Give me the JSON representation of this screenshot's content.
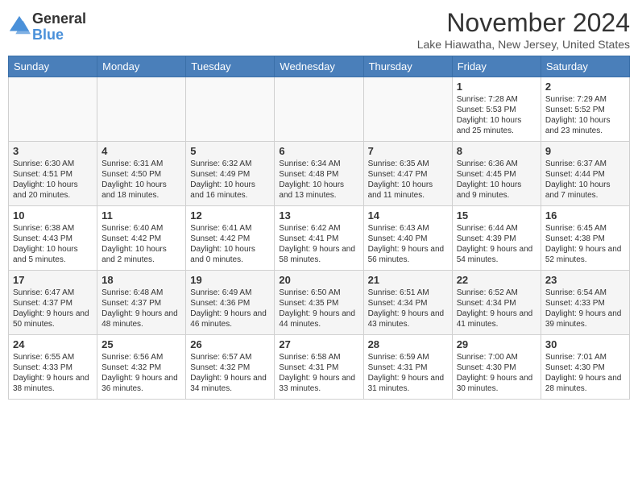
{
  "header": {
    "logo_line1": "General",
    "logo_line2": "Blue",
    "month": "November 2024",
    "location": "Lake Hiawatha, New Jersey, United States"
  },
  "days_of_week": [
    "Sunday",
    "Monday",
    "Tuesday",
    "Wednesday",
    "Thursday",
    "Friday",
    "Saturday"
  ],
  "weeks": [
    [
      {
        "day": "",
        "info": ""
      },
      {
        "day": "",
        "info": ""
      },
      {
        "day": "",
        "info": ""
      },
      {
        "day": "",
        "info": ""
      },
      {
        "day": "",
        "info": ""
      },
      {
        "day": "1",
        "info": "Sunrise: 7:28 AM\nSunset: 5:53 PM\nDaylight: 10 hours and 25 minutes."
      },
      {
        "day": "2",
        "info": "Sunrise: 7:29 AM\nSunset: 5:52 PM\nDaylight: 10 hours and 23 minutes."
      }
    ],
    [
      {
        "day": "3",
        "info": "Sunrise: 6:30 AM\nSunset: 4:51 PM\nDaylight: 10 hours and 20 minutes."
      },
      {
        "day": "4",
        "info": "Sunrise: 6:31 AM\nSunset: 4:50 PM\nDaylight: 10 hours and 18 minutes."
      },
      {
        "day": "5",
        "info": "Sunrise: 6:32 AM\nSunset: 4:49 PM\nDaylight: 10 hours and 16 minutes."
      },
      {
        "day": "6",
        "info": "Sunrise: 6:34 AM\nSunset: 4:48 PM\nDaylight: 10 hours and 13 minutes."
      },
      {
        "day": "7",
        "info": "Sunrise: 6:35 AM\nSunset: 4:47 PM\nDaylight: 10 hours and 11 minutes."
      },
      {
        "day": "8",
        "info": "Sunrise: 6:36 AM\nSunset: 4:45 PM\nDaylight: 10 hours and 9 minutes."
      },
      {
        "day": "9",
        "info": "Sunrise: 6:37 AM\nSunset: 4:44 PM\nDaylight: 10 hours and 7 minutes."
      }
    ],
    [
      {
        "day": "10",
        "info": "Sunrise: 6:38 AM\nSunset: 4:43 PM\nDaylight: 10 hours and 5 minutes."
      },
      {
        "day": "11",
        "info": "Sunrise: 6:40 AM\nSunset: 4:42 PM\nDaylight: 10 hours and 2 minutes."
      },
      {
        "day": "12",
        "info": "Sunrise: 6:41 AM\nSunset: 4:42 PM\nDaylight: 10 hours and 0 minutes."
      },
      {
        "day": "13",
        "info": "Sunrise: 6:42 AM\nSunset: 4:41 PM\nDaylight: 9 hours and 58 minutes."
      },
      {
        "day": "14",
        "info": "Sunrise: 6:43 AM\nSunset: 4:40 PM\nDaylight: 9 hours and 56 minutes."
      },
      {
        "day": "15",
        "info": "Sunrise: 6:44 AM\nSunset: 4:39 PM\nDaylight: 9 hours and 54 minutes."
      },
      {
        "day": "16",
        "info": "Sunrise: 6:45 AM\nSunset: 4:38 PM\nDaylight: 9 hours and 52 minutes."
      }
    ],
    [
      {
        "day": "17",
        "info": "Sunrise: 6:47 AM\nSunset: 4:37 PM\nDaylight: 9 hours and 50 minutes."
      },
      {
        "day": "18",
        "info": "Sunrise: 6:48 AM\nSunset: 4:37 PM\nDaylight: 9 hours and 48 minutes."
      },
      {
        "day": "19",
        "info": "Sunrise: 6:49 AM\nSunset: 4:36 PM\nDaylight: 9 hours and 46 minutes."
      },
      {
        "day": "20",
        "info": "Sunrise: 6:50 AM\nSunset: 4:35 PM\nDaylight: 9 hours and 44 minutes."
      },
      {
        "day": "21",
        "info": "Sunrise: 6:51 AM\nSunset: 4:34 PM\nDaylight: 9 hours and 43 minutes."
      },
      {
        "day": "22",
        "info": "Sunrise: 6:52 AM\nSunset: 4:34 PM\nDaylight: 9 hours and 41 minutes."
      },
      {
        "day": "23",
        "info": "Sunrise: 6:54 AM\nSunset: 4:33 PM\nDaylight: 9 hours and 39 minutes."
      }
    ],
    [
      {
        "day": "24",
        "info": "Sunrise: 6:55 AM\nSunset: 4:33 PM\nDaylight: 9 hours and 38 minutes."
      },
      {
        "day": "25",
        "info": "Sunrise: 6:56 AM\nSunset: 4:32 PM\nDaylight: 9 hours and 36 minutes."
      },
      {
        "day": "26",
        "info": "Sunrise: 6:57 AM\nSunset: 4:32 PM\nDaylight: 9 hours and 34 minutes."
      },
      {
        "day": "27",
        "info": "Sunrise: 6:58 AM\nSunset: 4:31 PM\nDaylight: 9 hours and 33 minutes."
      },
      {
        "day": "28",
        "info": "Sunrise: 6:59 AM\nSunset: 4:31 PM\nDaylight: 9 hours and 31 minutes."
      },
      {
        "day": "29",
        "info": "Sunrise: 7:00 AM\nSunset: 4:30 PM\nDaylight: 9 hours and 30 minutes."
      },
      {
        "day": "30",
        "info": "Sunrise: 7:01 AM\nSunset: 4:30 PM\nDaylight: 9 hours and 28 minutes."
      }
    ]
  ]
}
